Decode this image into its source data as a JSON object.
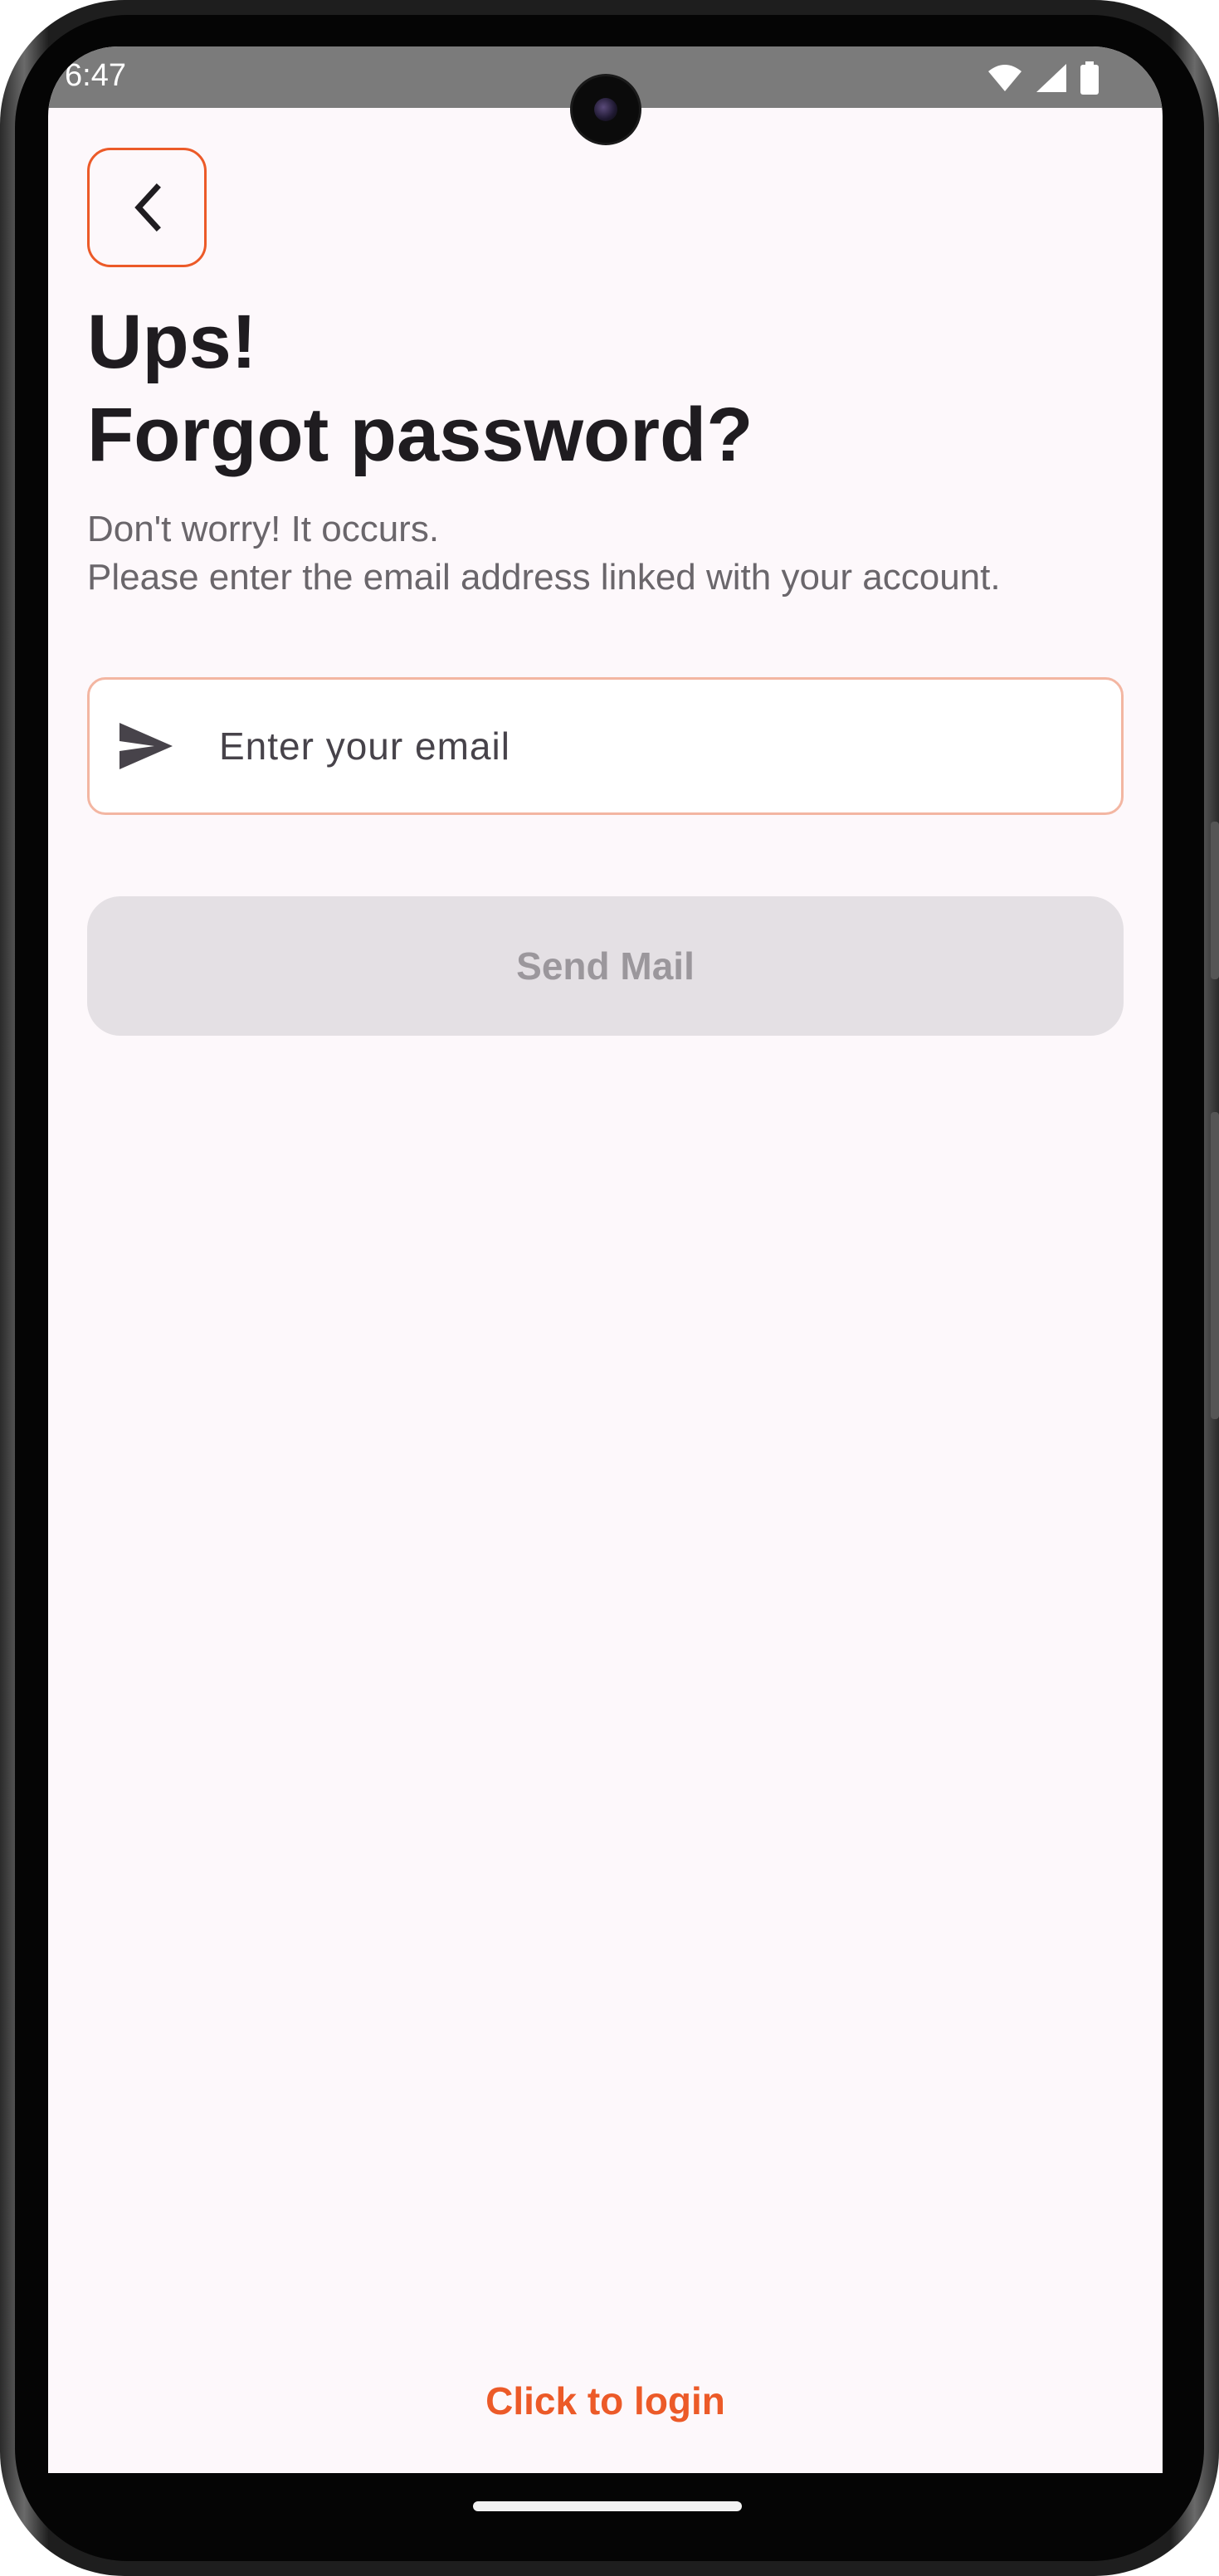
{
  "status_bar": {
    "time": "6:47",
    "icons": [
      "wifi-icon",
      "cellular-signal-icon",
      "battery-icon"
    ]
  },
  "header": {
    "back_icon": "chevron-left-icon",
    "title_line1": "Ups!",
    "title_line2": "Forgot password?",
    "subtitle_line1": "Don't worry! It occurs.",
    "subtitle_line2": "Please enter the email address linked with your account."
  },
  "form": {
    "email_icon": "send-icon",
    "email_placeholder": "Enter your email",
    "email_value": "",
    "send_label": "Send Mail",
    "send_enabled": false
  },
  "footer": {
    "login_link": "Click to login"
  },
  "colors": {
    "accent": "#ec5a28",
    "field_border": "#f3b6a2",
    "background": "#fdf8fb",
    "title_text": "#1f1c20",
    "disabled_button": "#e4e0e4",
    "disabled_text": "#9b979c"
  }
}
